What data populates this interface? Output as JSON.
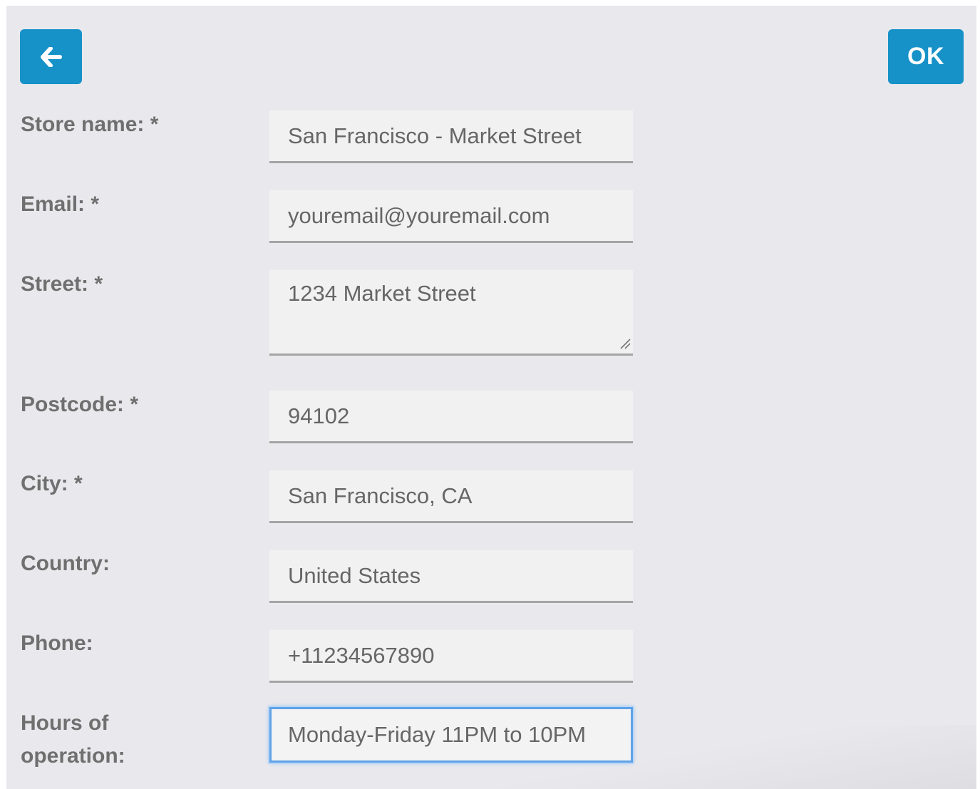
{
  "header": {
    "back_icon": "arrow-left-icon",
    "ok_label": "OK"
  },
  "colors": {
    "accent": "#1692c8",
    "panel_bg": "#e9e9ed",
    "field_bg": "#f1f1f1",
    "label_text": "#6f6f6f",
    "focus_ring": "#5fa2e8"
  },
  "form": {
    "store_name": {
      "label": "Store name: *",
      "value": "San Francisco - Market Street"
    },
    "email": {
      "label": "Email: *",
      "value": "youremail@youremail.com"
    },
    "street": {
      "label": "Street: *",
      "value": "1234 Market Street"
    },
    "postcode": {
      "label": "Postcode: *",
      "value": "94102"
    },
    "city": {
      "label": "City: *",
      "value": "San Francisco, CA"
    },
    "country": {
      "label": "Country:",
      "value": "United States"
    },
    "phone": {
      "label": "Phone:",
      "value": "+11234567890"
    },
    "hours": {
      "label_line1": "Hours of",
      "label_line2": "operation:",
      "value": "Monday-Friday 11PM to 10PM"
    }
  }
}
